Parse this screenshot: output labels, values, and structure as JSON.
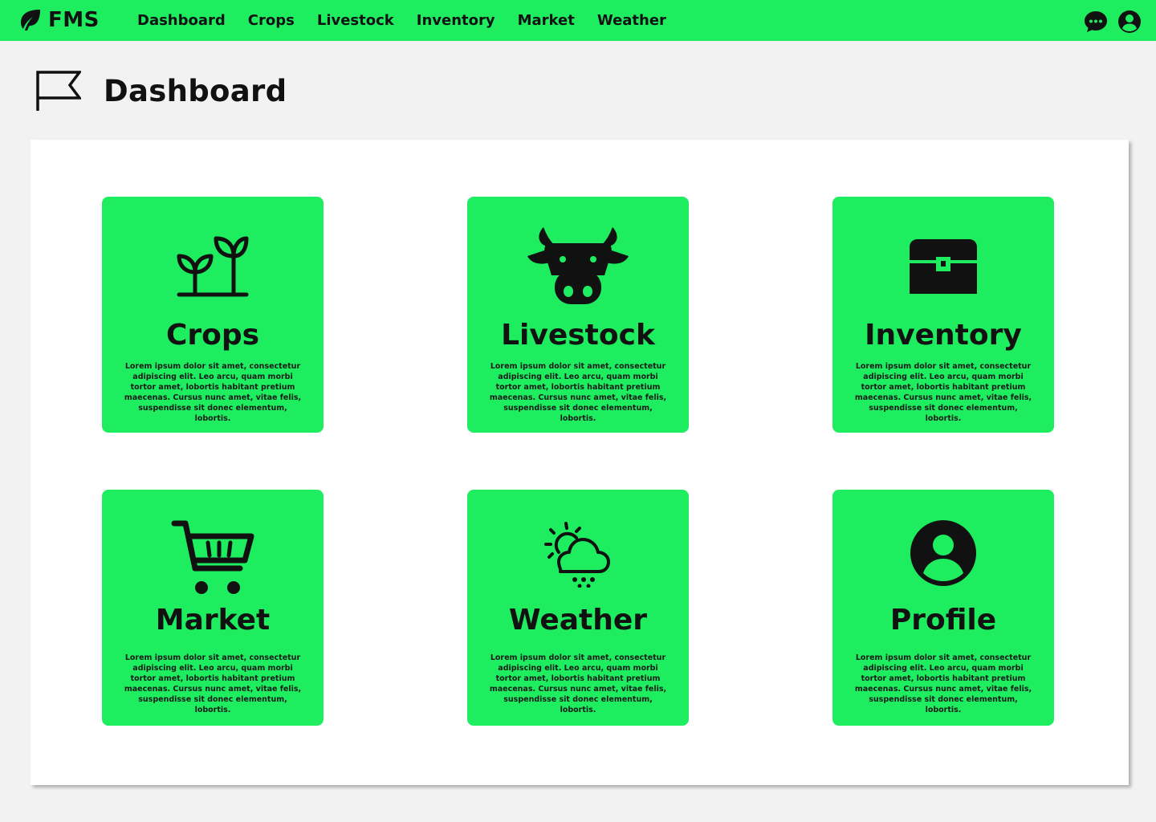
{
  "brand": {
    "name": "FMS",
    "icon": "leaf-icon"
  },
  "nav": {
    "links": [
      "Dashboard",
      "Crops",
      "Livestock",
      "Inventory",
      "Market",
      "Weather"
    ],
    "right_icons": [
      "chat-icon",
      "user-icon"
    ]
  },
  "page": {
    "title": "Dashboard",
    "icon": "flag-icon"
  },
  "colors": {
    "accent": "#1ded5f",
    "background": "#f2f2f2",
    "panel": "#ffffff",
    "ink": "#111111"
  },
  "cards": [
    {
      "title": "Crops",
      "icon": "sprout-icon",
      "description": "Lorem ipsum dolor sit amet, consectetur adipiscing elit. Leo arcu, quam morbi tortor amet, lobortis habitant pretium maecenas. Cursus nunc amet, vitae felis, suspendisse sit donec elementum, lobortis."
    },
    {
      "title": "Livestock",
      "icon": "cow-icon",
      "description": "Lorem ipsum dolor sit amet, consectetur adipiscing elit. Leo arcu, quam morbi tortor amet, lobortis habitant pretium maecenas. Cursus nunc amet, vitae felis, suspendisse sit donec elementum, lobortis."
    },
    {
      "title": "Inventory",
      "icon": "chest-icon",
      "description": "Lorem ipsum dolor sit amet, consectetur adipiscing elit. Leo arcu, quam morbi tortor amet, lobortis habitant pretium maecenas. Cursus nunc amet, vitae felis, suspendisse sit donec elementum, lobortis."
    },
    {
      "title": "Market",
      "icon": "cart-icon",
      "description": "Lorem ipsum dolor sit amet, consectetur adipiscing elit. Leo arcu, quam morbi tortor amet, lobortis habitant pretium maecenas. Cursus nunc amet, vitae felis, suspendisse sit donec elementum, lobortis."
    },
    {
      "title": "Weather",
      "icon": "weather-icon",
      "description": "Lorem ipsum dolor sit amet, consectetur adipiscing elit. Leo arcu, quam morbi tortor amet, lobortis habitant pretium maecenas. Cursus nunc amet, vitae felis, suspendisse sit donec elementum, lobortis."
    },
    {
      "title": "Profile",
      "icon": "profile-icon",
      "description": "Lorem ipsum dolor sit amet, consectetur adipiscing elit. Leo arcu, quam morbi tortor amet, lobortis habitant pretium maecenas. Cursus nunc amet, vitae felis, suspendisse sit donec elementum, lobortis."
    }
  ]
}
